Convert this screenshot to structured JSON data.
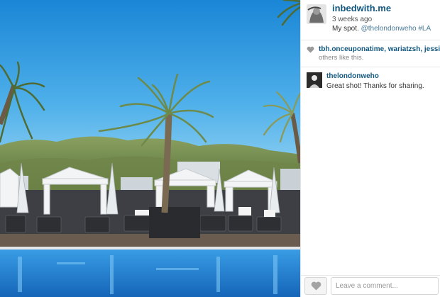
{
  "post": {
    "username": "inbedwith.me",
    "time_ago": "3 weeks ago",
    "caption_text": "My spot.",
    "caption_mention": "@thelondonweho",
    "caption_hashtag": "#LA"
  },
  "likes": {
    "users_text": "tbh.onceuponatime, wariatzsh, jessicak",
    "others_text": "others like this."
  },
  "comments": [
    {
      "username": "thelondonweho",
      "text": "Great shot! Thanks for sharing."
    }
  ],
  "composer": {
    "placeholder": "Leave a comment..."
  },
  "icons": {
    "like": "heart-icon",
    "likes_summary": "heart-icon"
  },
  "colors": {
    "username_blue": "#12577f",
    "sky": "#1f8fdc",
    "pool": "#1e7fd0"
  }
}
